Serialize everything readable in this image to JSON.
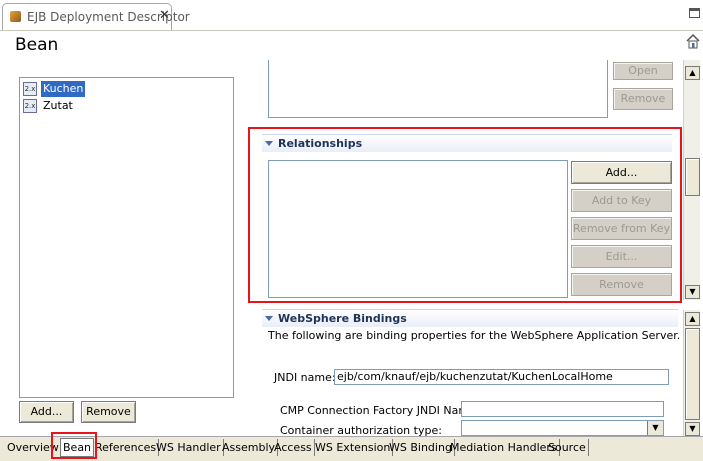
{
  "editor": {
    "tab_title": "EJB Deployment Descriptor",
    "close_glyph": "✕"
  },
  "page": {
    "title": "Bean"
  },
  "bean_list": {
    "items": [
      {
        "label": "Kuchen",
        "icon": "entity-bean-icon",
        "selected": true
      },
      {
        "label": "Zutat",
        "icon": "entity-bean-icon",
        "selected": false
      }
    ],
    "add_label": "Add...",
    "remove_label": "Remove"
  },
  "upper_section": {
    "open_label": "Open",
    "remove_label": "Remove"
  },
  "relationships": {
    "title": "Relationships",
    "buttons": {
      "add": "Add...",
      "add_to_key": "Add to Key",
      "remove_from_key": "Remove from Key",
      "edit": "Edit...",
      "remove": "Remove"
    }
  },
  "websphere_bindings": {
    "title": "WebSphere Bindings",
    "description": "The following are binding properties for the WebSphere Application Server.",
    "jndi_label": "JNDI name:",
    "jndi_value": "ejb/com/knauf/ejb/kuchenzutat/KuchenLocalHome",
    "cmp_label": "CMP Connection Factory JNDI Name:",
    "cmp_value": "",
    "auth_label": "Container authorization type:",
    "auth_value": ""
  },
  "page_tabs": {
    "items": [
      {
        "label": "Overview",
        "active": false
      },
      {
        "label": "Bean",
        "active": true
      },
      {
        "label": "References",
        "active": false
      },
      {
        "label": "WS Handler",
        "active": false
      },
      {
        "label": "Assembly",
        "active": false
      },
      {
        "label": "Access",
        "active": false
      },
      {
        "label": "WS Extension",
        "active": false
      },
      {
        "label": "WS Binding",
        "active": false
      },
      {
        "label": "Mediation Handlers",
        "active": false
      },
      {
        "label": "Source",
        "active": false
      }
    ]
  },
  "colors": {
    "highlight": "#e8141b",
    "selection": "#316ac5",
    "section_title": "#1f3257"
  }
}
